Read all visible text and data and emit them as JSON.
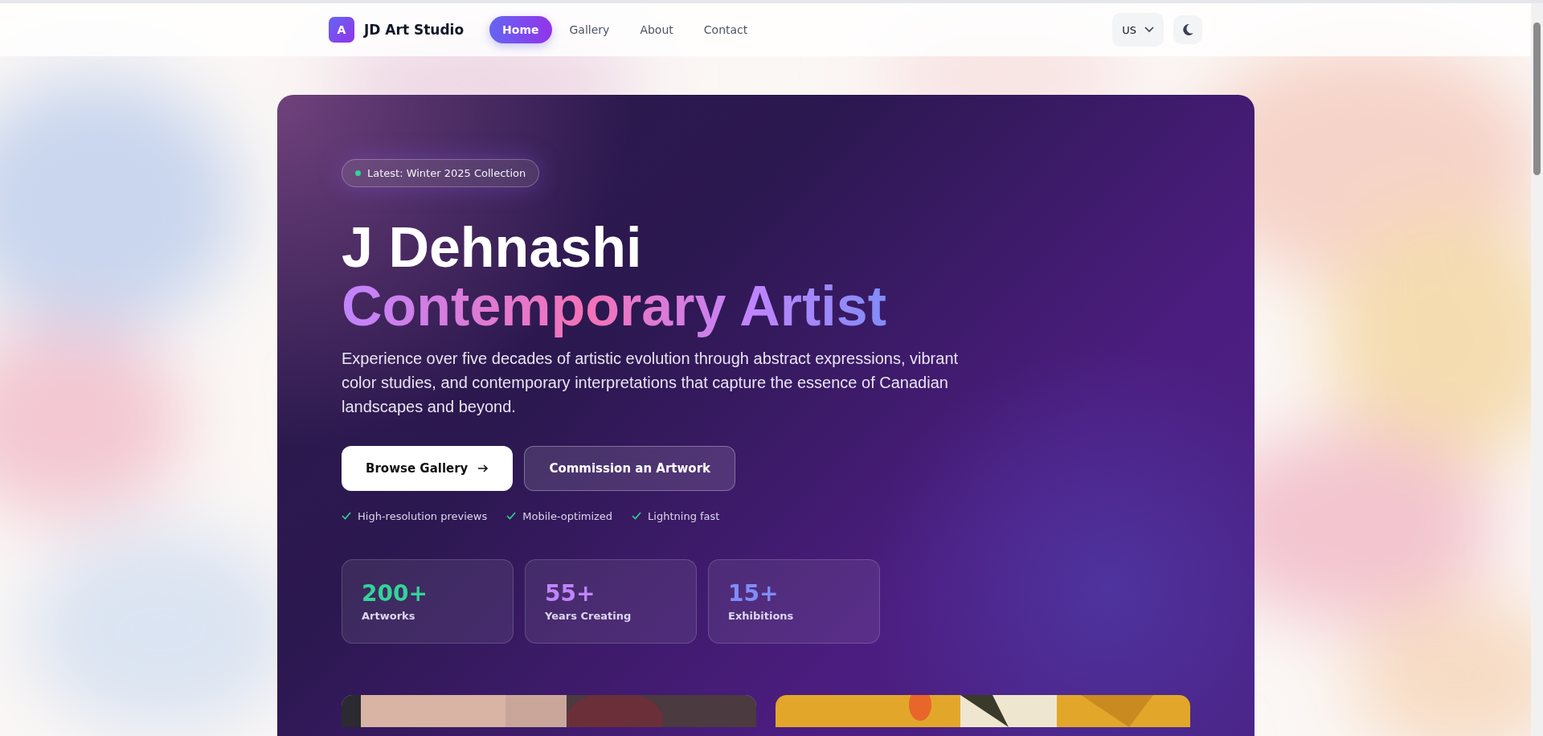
{
  "header": {
    "logo_letter": "A",
    "brand": "JD Art Studio",
    "nav": [
      {
        "label": "Home",
        "selected": true
      },
      {
        "label": "Gallery",
        "selected": false
      },
      {
        "label": "About",
        "selected": false
      },
      {
        "label": "Contact",
        "selected": false
      }
    ],
    "region_select": {
      "value": "US"
    },
    "theme_toggle": {
      "dark": false
    }
  },
  "hero": {
    "badge": {
      "text": "Latest: Winter 2025 Collection",
      "color": "#34d399"
    },
    "title": "J Dehnashi",
    "subtitle": "Contemporary Artist",
    "description": "Experience over five decades of artistic evolution through abstract expressions, vibrant color studies, and contemporary interpretations that capture the essence of Canadian landscapes and beyond.",
    "buttons": [
      {
        "label": "Browse Gallery",
        "kind": "primary"
      },
      {
        "label": "Commission an Artwork",
        "kind": "outline"
      }
    ],
    "features": [
      "High-resolution previews",
      "Mobile-optimized",
      "Lightning fast"
    ],
    "stats": [
      {
        "value": "200+",
        "label": "Artworks",
        "color": "#34d399"
      },
      {
        "value": "55+",
        "label": "Years Creating",
        "color": "#c084fc"
      },
      {
        "value": "15+",
        "label": "Exhibitions",
        "color": "#818cf8"
      }
    ],
    "previews": [
      {
        "kind": "picture"
      },
      {
        "kind": "picture"
      }
    ]
  }
}
